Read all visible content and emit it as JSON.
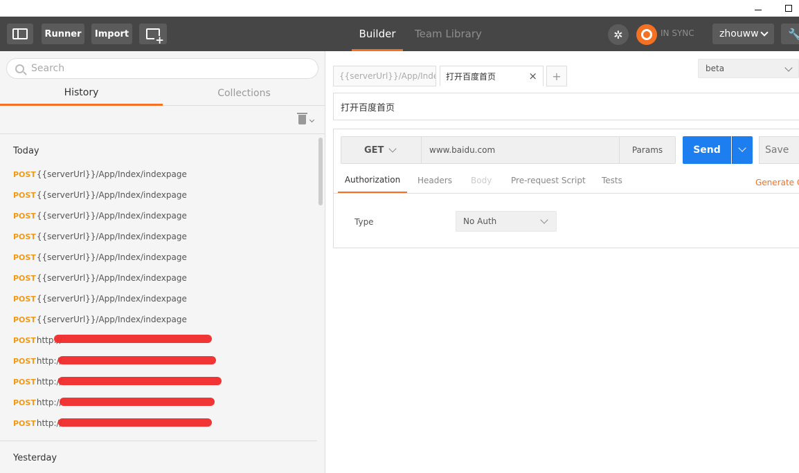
{
  "toolbar": {
    "runner_label": "Runner",
    "import_label": "Import",
    "tabs": [
      {
        "label": "Builder",
        "active": true
      },
      {
        "label": "Team Library",
        "active": false
      }
    ],
    "sync_status": "IN SYNC",
    "username": "zhouww",
    "accent_color": "#f47023"
  },
  "sidebar": {
    "search_placeholder": "Search",
    "tabs": [
      {
        "label": "History",
        "active": true
      },
      {
        "label": "Collections",
        "active": false
      }
    ],
    "groups": [
      {
        "title": "Today",
        "items": [
          {
            "method": "POST",
            "url": "{{serverUrl}}/App/Index/indexpage"
          },
          {
            "method": "POST",
            "url": "{{serverUrl}}/App/Index/indexpage"
          },
          {
            "method": "POST",
            "url": "{{serverUrl}}/App/Index/indexpage"
          },
          {
            "method": "POST",
            "url": "{{serverUrl}}/App/Index/indexpage"
          },
          {
            "method": "POST",
            "url": "{{serverUrl}}/App/Index/indexpage"
          },
          {
            "method": "POST",
            "url": "{{serverUrl}}/App/Index/indexpage"
          },
          {
            "method": "POST",
            "url": "{{serverUrl}}/App/Index/indexpage"
          },
          {
            "method": "POST",
            "url": "{{serverUrl}}/App/Index/indexpage"
          },
          {
            "method": "POST",
            "url": "http://"
          },
          {
            "method": "POST",
            "url": "http://"
          },
          {
            "method": "POST",
            "url": "http://"
          },
          {
            "method": "POST",
            "url": "http://"
          },
          {
            "method": "POST",
            "url": "http://"
          }
        ]
      },
      {
        "title": "Yesterday",
        "items": []
      }
    ]
  },
  "builder": {
    "request_tabs": [
      {
        "label": "{{serverUrl}}/App/Index/indexpage",
        "active": false
      },
      {
        "label": "打开百度首页",
        "active": true
      }
    ],
    "environment": "beta",
    "request_name": "打开百度首页",
    "method": "GET",
    "url": "www.baidu.com",
    "params_label": "Params",
    "send_label": "Send",
    "save_label": "Save",
    "sub_tabs": [
      {
        "label": "Authorization",
        "active": true
      },
      {
        "label": "Headers",
        "active": false
      },
      {
        "label": "Body",
        "active": false,
        "disabled": true
      },
      {
        "label": "Pre-request Script",
        "active": false
      },
      {
        "label": "Tests",
        "active": false
      }
    ],
    "generate_code_label": "Generate Code",
    "auth_type_label": "Type",
    "auth_type_value": "No Auth",
    "send_color": "#1c7eef"
  }
}
